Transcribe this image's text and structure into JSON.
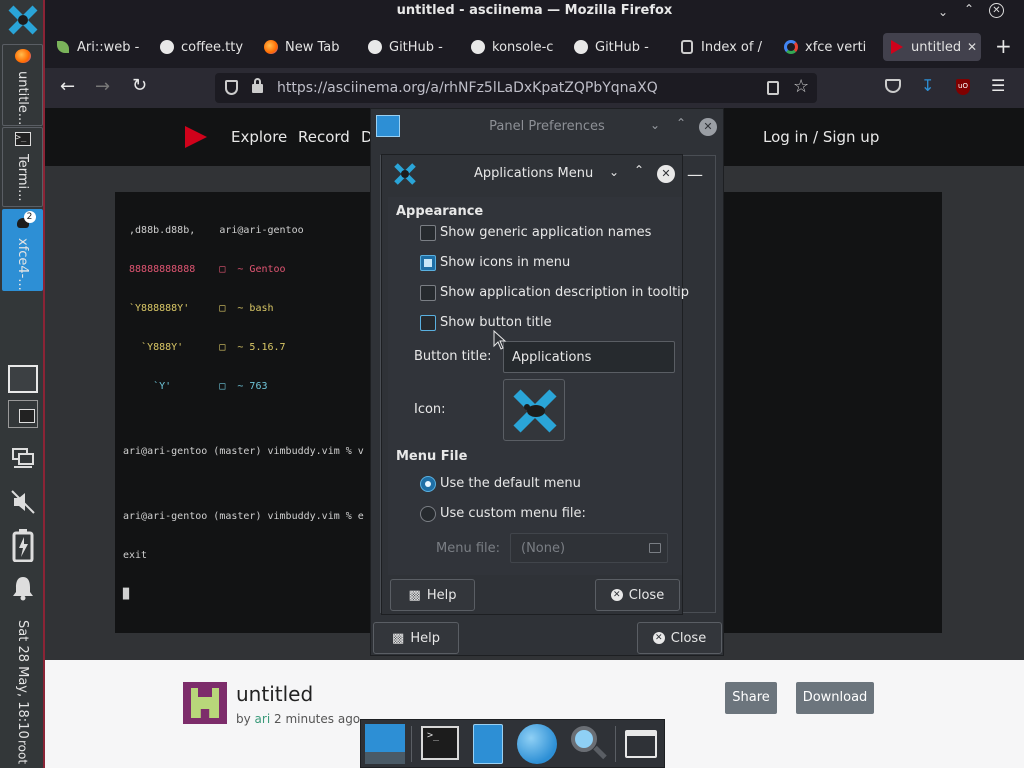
{
  "window": {
    "title": "untitled - asciinema — Mozilla Firefox"
  },
  "xfce_panel": {
    "items": [
      {
        "label": "untitle..."
      },
      {
        "label": "Termi..."
      },
      {
        "label": "xfce4-...",
        "badge": "2"
      }
    ],
    "clock": "Sat 28 May, 18:10",
    "user": "root"
  },
  "tabs": [
    {
      "label": "Ari::web -"
    },
    {
      "label": "coffee.tty"
    },
    {
      "label": "New Tab"
    },
    {
      "label": "GitHub - "
    },
    {
      "label": "konsole-c"
    },
    {
      "label": "GitHub - "
    },
    {
      "label": "Index of /"
    },
    {
      "label": "xfce verti"
    },
    {
      "label": "untitled"
    }
  ],
  "url": "https://asciinema.org/a/rhNFz5lLaDxKpatZQPbYqnaXQ",
  "site": {
    "nav": [
      "Explore",
      "Record",
      "D"
    ],
    "login": "Log in / Sign up",
    "recording_title": "untitled",
    "byline_prefix": "by",
    "author": "ari",
    "byline_suffix": "2 minutes ago",
    "share": "Share",
    "download": "Download"
  },
  "terminal": {
    "lines": [
      " ,d88b.d88b,    ari@ari-gentoo",
      " 88888888888    □  ~ Gentoo",
      " `Y888888Y'     □  ~ bash",
      "   `Y888Y'      □  ~ 5.16.7",
      "     `Y'        □  ~ 763",
      "",
      "ari@ari-gentoo (master) vimbuddy.vim % v",
      "",
      "ari@ari-gentoo (master) vimbuddy.vim % e",
      "exit",
      "█"
    ]
  },
  "panel_prefs": {
    "title": "Panel Preferences",
    "help": "Help",
    "close": "Close"
  },
  "app_menu": {
    "title": "Applications Menu",
    "appearance_heading": "Appearance",
    "options": [
      {
        "label": "Show generic application names",
        "checked": false
      },
      {
        "label": "Show icons in menu",
        "checked": true
      },
      {
        "label": "Show application description in tooltip",
        "checked": false
      },
      {
        "label": "Show button title",
        "checked": false
      }
    ],
    "button_title_label": "Button title:",
    "button_title_value": "Applications",
    "icon_label": "Icon:",
    "menu_file_heading": "Menu File",
    "radio_default": "Use the default menu",
    "radio_custom": "Use custom menu file:",
    "menu_file_label": "Menu file:",
    "menu_file_value": "(None)",
    "help": "Help",
    "close": "Close"
  },
  "colors": {
    "panel_accent": "#8b2436",
    "active_item": "#2d8fd5",
    "asciinema_red": "#d0021b",
    "link": "#3a9a7a"
  }
}
